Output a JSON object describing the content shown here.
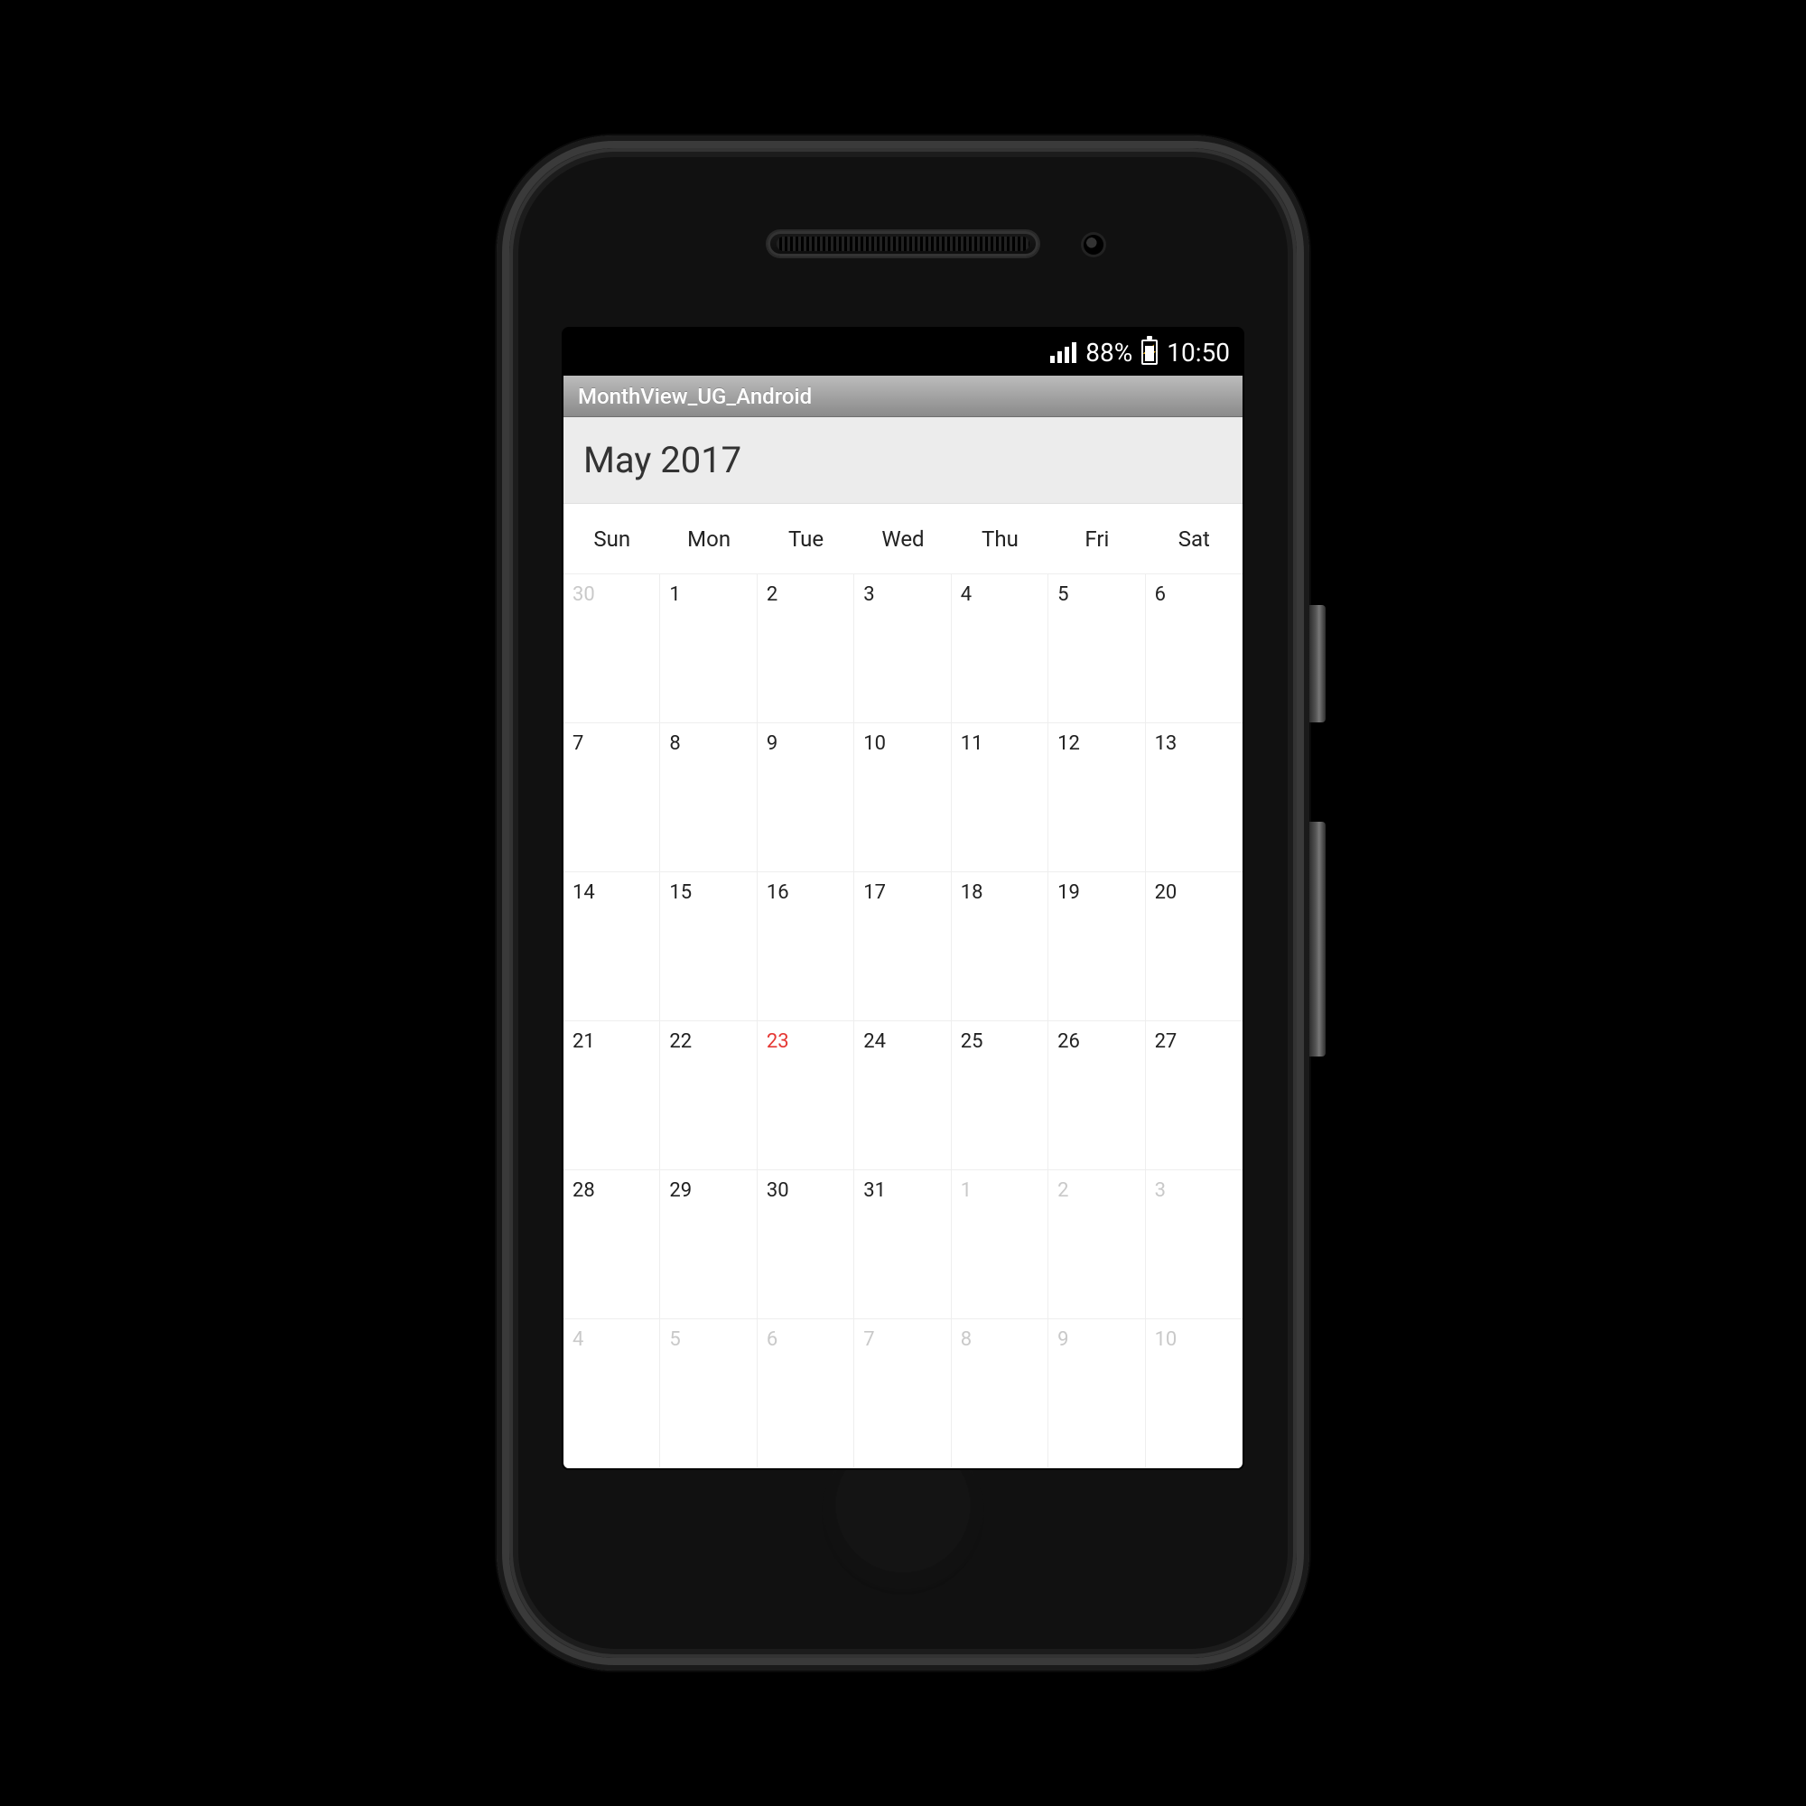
{
  "status": {
    "battery_pct": "88%",
    "clock": "10:50"
  },
  "titlebar": {
    "title": "MonthView_UG_Android"
  },
  "calendar": {
    "header": "May 2017",
    "dow": [
      "Sun",
      "Mon",
      "Tue",
      "Wed",
      "Thu",
      "Fri",
      "Sat"
    ],
    "weeks": [
      [
        {
          "d": "30",
          "trail": true
        },
        {
          "d": "1"
        },
        {
          "d": "2"
        },
        {
          "d": "3"
        },
        {
          "d": "4"
        },
        {
          "d": "5"
        },
        {
          "d": "6"
        }
      ],
      [
        {
          "d": "7"
        },
        {
          "d": "8"
        },
        {
          "d": "9"
        },
        {
          "d": "10"
        },
        {
          "d": "11"
        },
        {
          "d": "12"
        },
        {
          "d": "13"
        }
      ],
      [
        {
          "d": "14"
        },
        {
          "d": "15"
        },
        {
          "d": "16"
        },
        {
          "d": "17"
        },
        {
          "d": "18"
        },
        {
          "d": "19"
        },
        {
          "d": "20"
        }
      ],
      [
        {
          "d": "21"
        },
        {
          "d": "22"
        },
        {
          "d": "23",
          "today": true
        },
        {
          "d": "24"
        },
        {
          "d": "25"
        },
        {
          "d": "26"
        },
        {
          "d": "27"
        }
      ],
      [
        {
          "d": "28"
        },
        {
          "d": "29"
        },
        {
          "d": "30"
        },
        {
          "d": "31"
        },
        {
          "d": "1",
          "trail": true
        },
        {
          "d": "2",
          "trail": true
        },
        {
          "d": "3",
          "trail": true
        }
      ],
      [
        {
          "d": "4",
          "trail": true
        },
        {
          "d": "5",
          "trail": true
        },
        {
          "d": "6",
          "trail": true
        },
        {
          "d": "7",
          "trail": true
        },
        {
          "d": "8",
          "trail": true
        },
        {
          "d": "9",
          "trail": true
        },
        {
          "d": "10",
          "trail": true
        }
      ]
    ]
  }
}
